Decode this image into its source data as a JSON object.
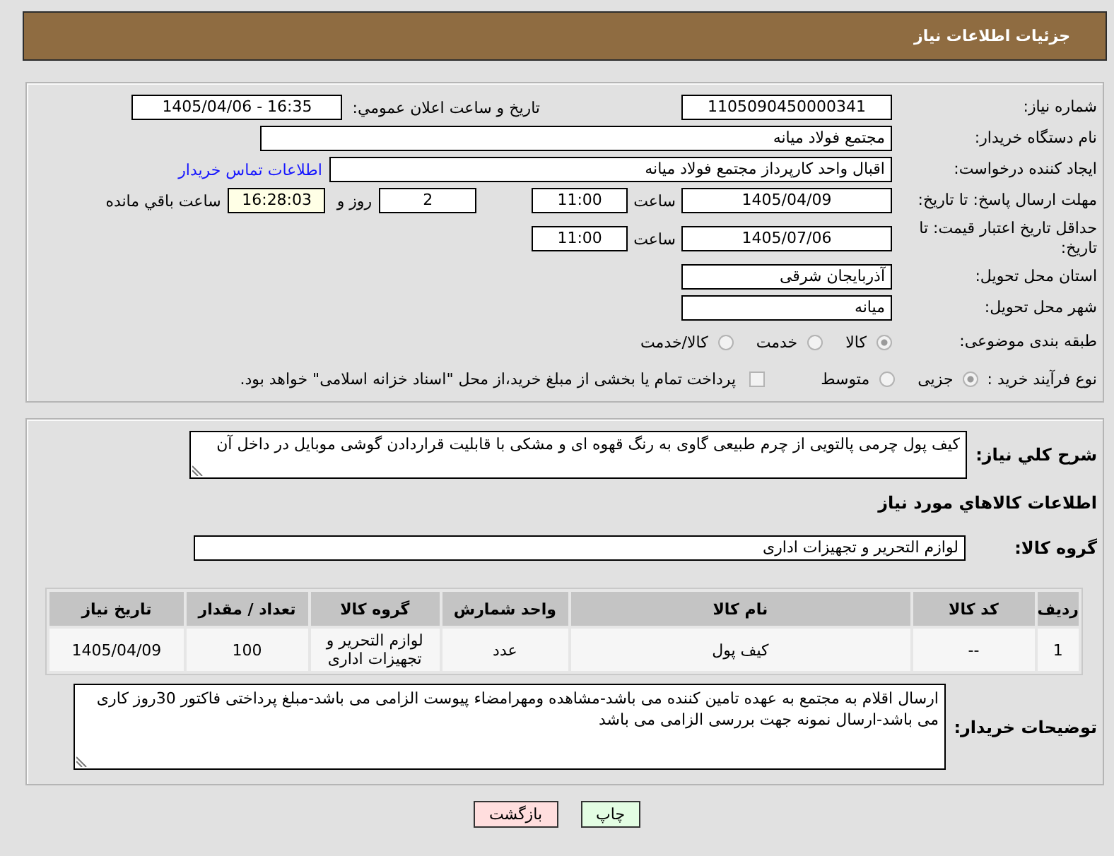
{
  "header": {
    "title": "جزئیات اطلاعات نیاز"
  },
  "need_info": {
    "need_number": {
      "label": "شماره نیاز:",
      "value": "1105090450000341"
    },
    "announce_datetime": {
      "label": "تاريخ و ساعت اعلان عمومي:",
      "value": "1405/04/06 - 16:35"
    },
    "buyer_org": {
      "label": "نام دستگاه خریدار:",
      "value": "مجتمع فولاد میانه"
    },
    "requester": {
      "label": "ایجاد کننده درخواست:",
      "value": "اقبال واحد کارپرداز مجتمع فولاد میانه",
      "link": "اطلاعات تماس خریدار"
    },
    "response_deadline": {
      "label": "مهلت ارسال پاسخ: تا تاریخ:",
      "date": "1405/04/09",
      "time_label": "ساعت",
      "time": "11:00",
      "days": "2",
      "days_label": "روز و",
      "remaining": "16:28:03",
      "remaining_label": "ساعت باقي مانده"
    },
    "price_validity": {
      "label": "حداقل تاریخ اعتبار قیمت: تا تاریخ:",
      "date": "1405/07/06",
      "time_label": "ساعت",
      "time": "11:00"
    },
    "delivery_province": {
      "label": "استان محل تحویل:",
      "value": "آذربایجان شرقی"
    },
    "delivery_city": {
      "label": "شهر محل تحویل:",
      "value": "میانه"
    },
    "classification": {
      "label": "طبقه بندی موضوعی:",
      "options": [
        {
          "label": "کالا",
          "selected": true
        },
        {
          "label": "خدمت",
          "selected": false
        },
        {
          "label": "کالا/خدمت",
          "selected": false
        }
      ]
    },
    "purchase_process": {
      "label": "نوع فرآیند خرید :",
      "options": [
        {
          "label": "جزیی",
          "selected": true
        },
        {
          "label": "متوسط",
          "selected": false
        }
      ],
      "treasury_payment": {
        "label": "پرداخت تمام یا بخشی از مبلغ خرید،از محل \"اسناد خزانه اسلامی\" خواهد بود.",
        "checked": false
      }
    }
  },
  "need_summary": {
    "description": {
      "label": "شرح کلي نياز:",
      "value": "کیف پول چرمی پالتویی از چرم طبیعی گاوی به رنگ قهوه ای و مشکی با قابلیت قراردادن گوشی موبایل در داخل آن"
    },
    "goods_heading": "اطلاعات کالاهاي مورد نياز",
    "goods_group": {
      "label": "گروه کالا:",
      "value": "لوازم التحریر و تجهیزات اداری"
    },
    "table": {
      "columns": [
        "ردیف",
        "کد کالا",
        "نام کالا",
        "واحد شمارش",
        "گروه کالا",
        "تعداد / مقدار",
        "تاریخ نیاز"
      ],
      "rows": [
        [
          "1",
          "--",
          "کیف پول",
          "عدد",
          "لوازم التحریر و تجهیزات اداری",
          "100",
          "1405/04/09"
        ]
      ]
    },
    "buyer_notes": {
      "label": "توضیحات خریدار:",
      "value": "ارسال اقلام به مجتمع به عهده تامین کننده می باشد-مشاهده ومهرامضاء پیوست الزامی می باشد-مبلغ پرداختی فاکتور 30روز کاری می باشد-ارسال نمونه جهت بررسی الزامی می باشد"
    }
  },
  "buttons": [
    {
      "kind": "print",
      "label": "چاپ"
    },
    {
      "kind": "back",
      "label": "بازگشت"
    }
  ]
}
